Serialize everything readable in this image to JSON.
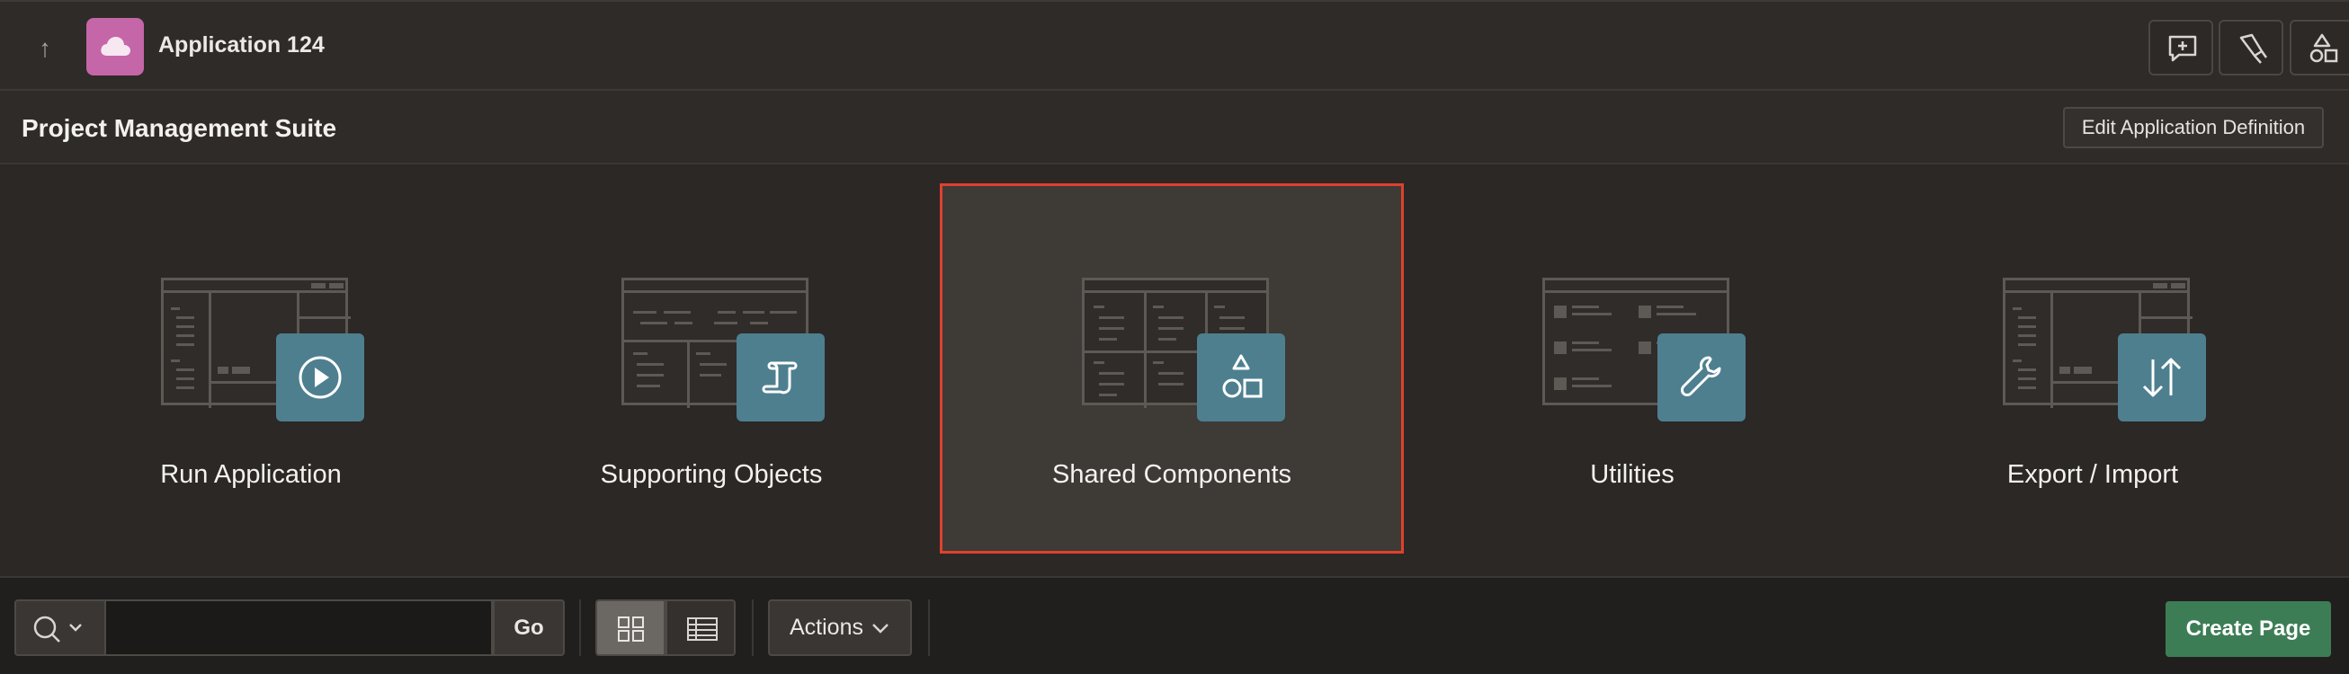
{
  "header": {
    "app_name": "Application 124"
  },
  "title_bar": {
    "title": "Project Management Suite",
    "edit_button": "Edit Application Definition"
  },
  "tiles": [
    {
      "label": "Run Application",
      "icon": "play-icon"
    },
    {
      "label": "Supporting Objects",
      "icon": "scroll-icon"
    },
    {
      "label": "Shared Components",
      "icon": "shapes-icon",
      "selected": true
    },
    {
      "label": "Utilities",
      "icon": "wrench-icon"
    },
    {
      "label": "Export / Import",
      "icon": "arrows-up-down-icon"
    }
  ],
  "toolbar": {
    "search_placeholder": "",
    "go_label": "Go",
    "actions_label": "Actions",
    "create_page_label": "Create Page",
    "active_view": "grid"
  },
  "colors": {
    "accent_selected_border": "#e0412d",
    "badge": "#4e7f8f",
    "app_icon": "#c566a8",
    "create_button": "#3d7d56"
  }
}
